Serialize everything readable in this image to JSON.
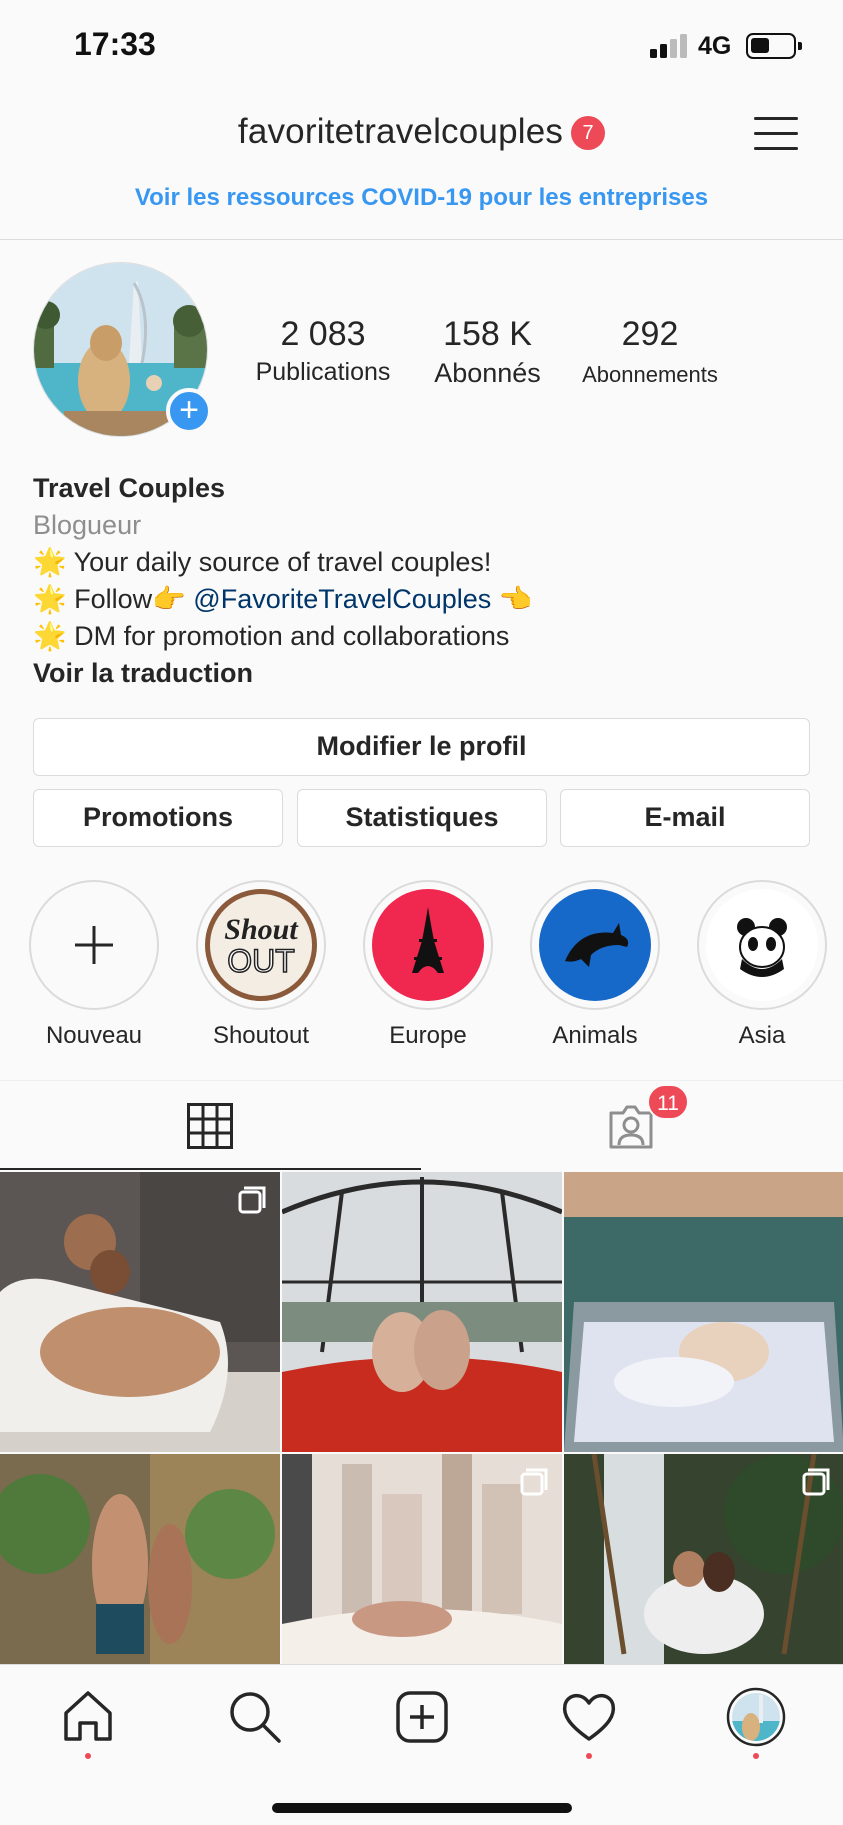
{
  "status_bar": {
    "time": "17:33",
    "network": "4G"
  },
  "header": {
    "username": "favoritetravelcouples",
    "notification_count": "7",
    "covid_link": "Voir les ressources COVID-19 pour les entreprises"
  },
  "stats": [
    {
      "value": "2 083",
      "label": "Publications"
    },
    {
      "value": "158 K",
      "label": "Abonnés"
    },
    {
      "value": "292",
      "label": "Abonnements"
    }
  ],
  "bio": {
    "name": "Travel Couples",
    "category": "Blogueur",
    "line1_emoji": "🌟",
    "line1": "Your daily source of travel couples!",
    "line2_emoji": "🌟",
    "line2_prefix": "Follow👉",
    "line2_mention": "@FavoriteTravelCouples",
    "line2_suffix": "👈",
    "line3_emoji": "🌟",
    "line3": "DM for promotion and collaborations",
    "see_translation": "Voir la traduction"
  },
  "buttons": {
    "edit_profile": "Modifier le profil",
    "promotions": "Promotions",
    "insights": "Statistiques",
    "email": "E-mail"
  },
  "highlights": [
    {
      "label": "Nouveau",
      "icon": "plus-icon"
    },
    {
      "label": "Shoutout",
      "icon": "shoutout-logo",
      "logo_text_1": "Shout",
      "logo_text_2": "OUT"
    },
    {
      "label": "Europe",
      "icon": "eiffel-tower-icon"
    },
    {
      "label": "Animals",
      "icon": "dolphin-icon"
    },
    {
      "label": "Asia",
      "icon": "panda-icon"
    }
  ],
  "tabs": {
    "grid_icon": "grid-icon",
    "tagged_icon": "tagged-user-icon",
    "tagged_count": "11"
  },
  "colors": {
    "accent": "#3897f0",
    "badge": "#ed4956",
    "text": "#262626",
    "secondary": "#8e8e8e",
    "europe_bg": "#f0284f",
    "animals_bg": "#1668c9"
  },
  "bottom_nav": [
    "home-icon",
    "search-icon",
    "add-post-icon",
    "activity-heart-icon",
    "profile-avatar-icon"
  ]
}
